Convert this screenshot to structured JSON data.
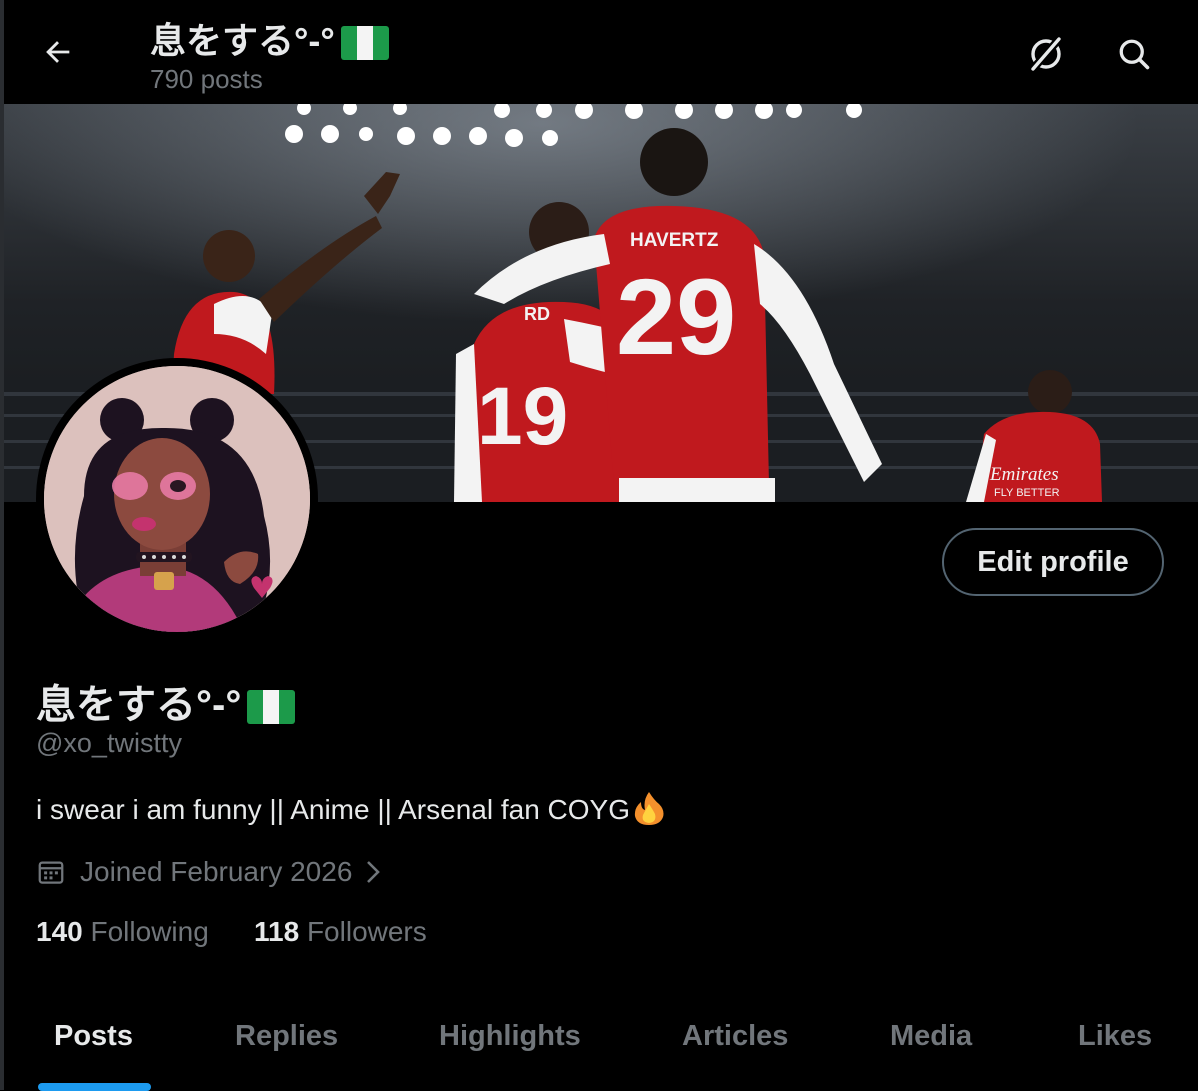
{
  "header": {
    "title": "息をする°-°",
    "posts_count": "790 posts",
    "back_icon": "arrow-left-icon",
    "grok_icon": "grok-icon",
    "search_icon": "search-icon"
  },
  "banner": {
    "jersey_names": [
      "HAVERTZ",
      "RD"
    ],
    "jersey_numbers": [
      "29",
      "19"
    ],
    "sponsor": "Emirates",
    "sponsor_sub": "FLY BETTER"
  },
  "profile": {
    "edit_button": "Edit profile",
    "display_name": "息をする°-°",
    "handle": "@xo_twistty",
    "bio": "i swear i am funny || Anime || Arsenal fan COYG",
    "joined": "Joined February 2026",
    "following_count": "140",
    "following_label": "Following",
    "followers_count": "118",
    "followers_label": "Followers"
  },
  "tabs": [
    {
      "label": "Posts",
      "active": true
    },
    {
      "label": "Replies",
      "active": false
    },
    {
      "label": "Highlights",
      "active": false
    },
    {
      "label": "Articles",
      "active": false
    },
    {
      "label": "Media",
      "active": false
    },
    {
      "label": "Likes",
      "active": false
    }
  ],
  "colors": {
    "accent": "#1d9bf0",
    "text_primary": "#e7e9ea",
    "text_secondary": "#71767b",
    "border": "#536471",
    "flag_green": "#1c9a4a"
  }
}
